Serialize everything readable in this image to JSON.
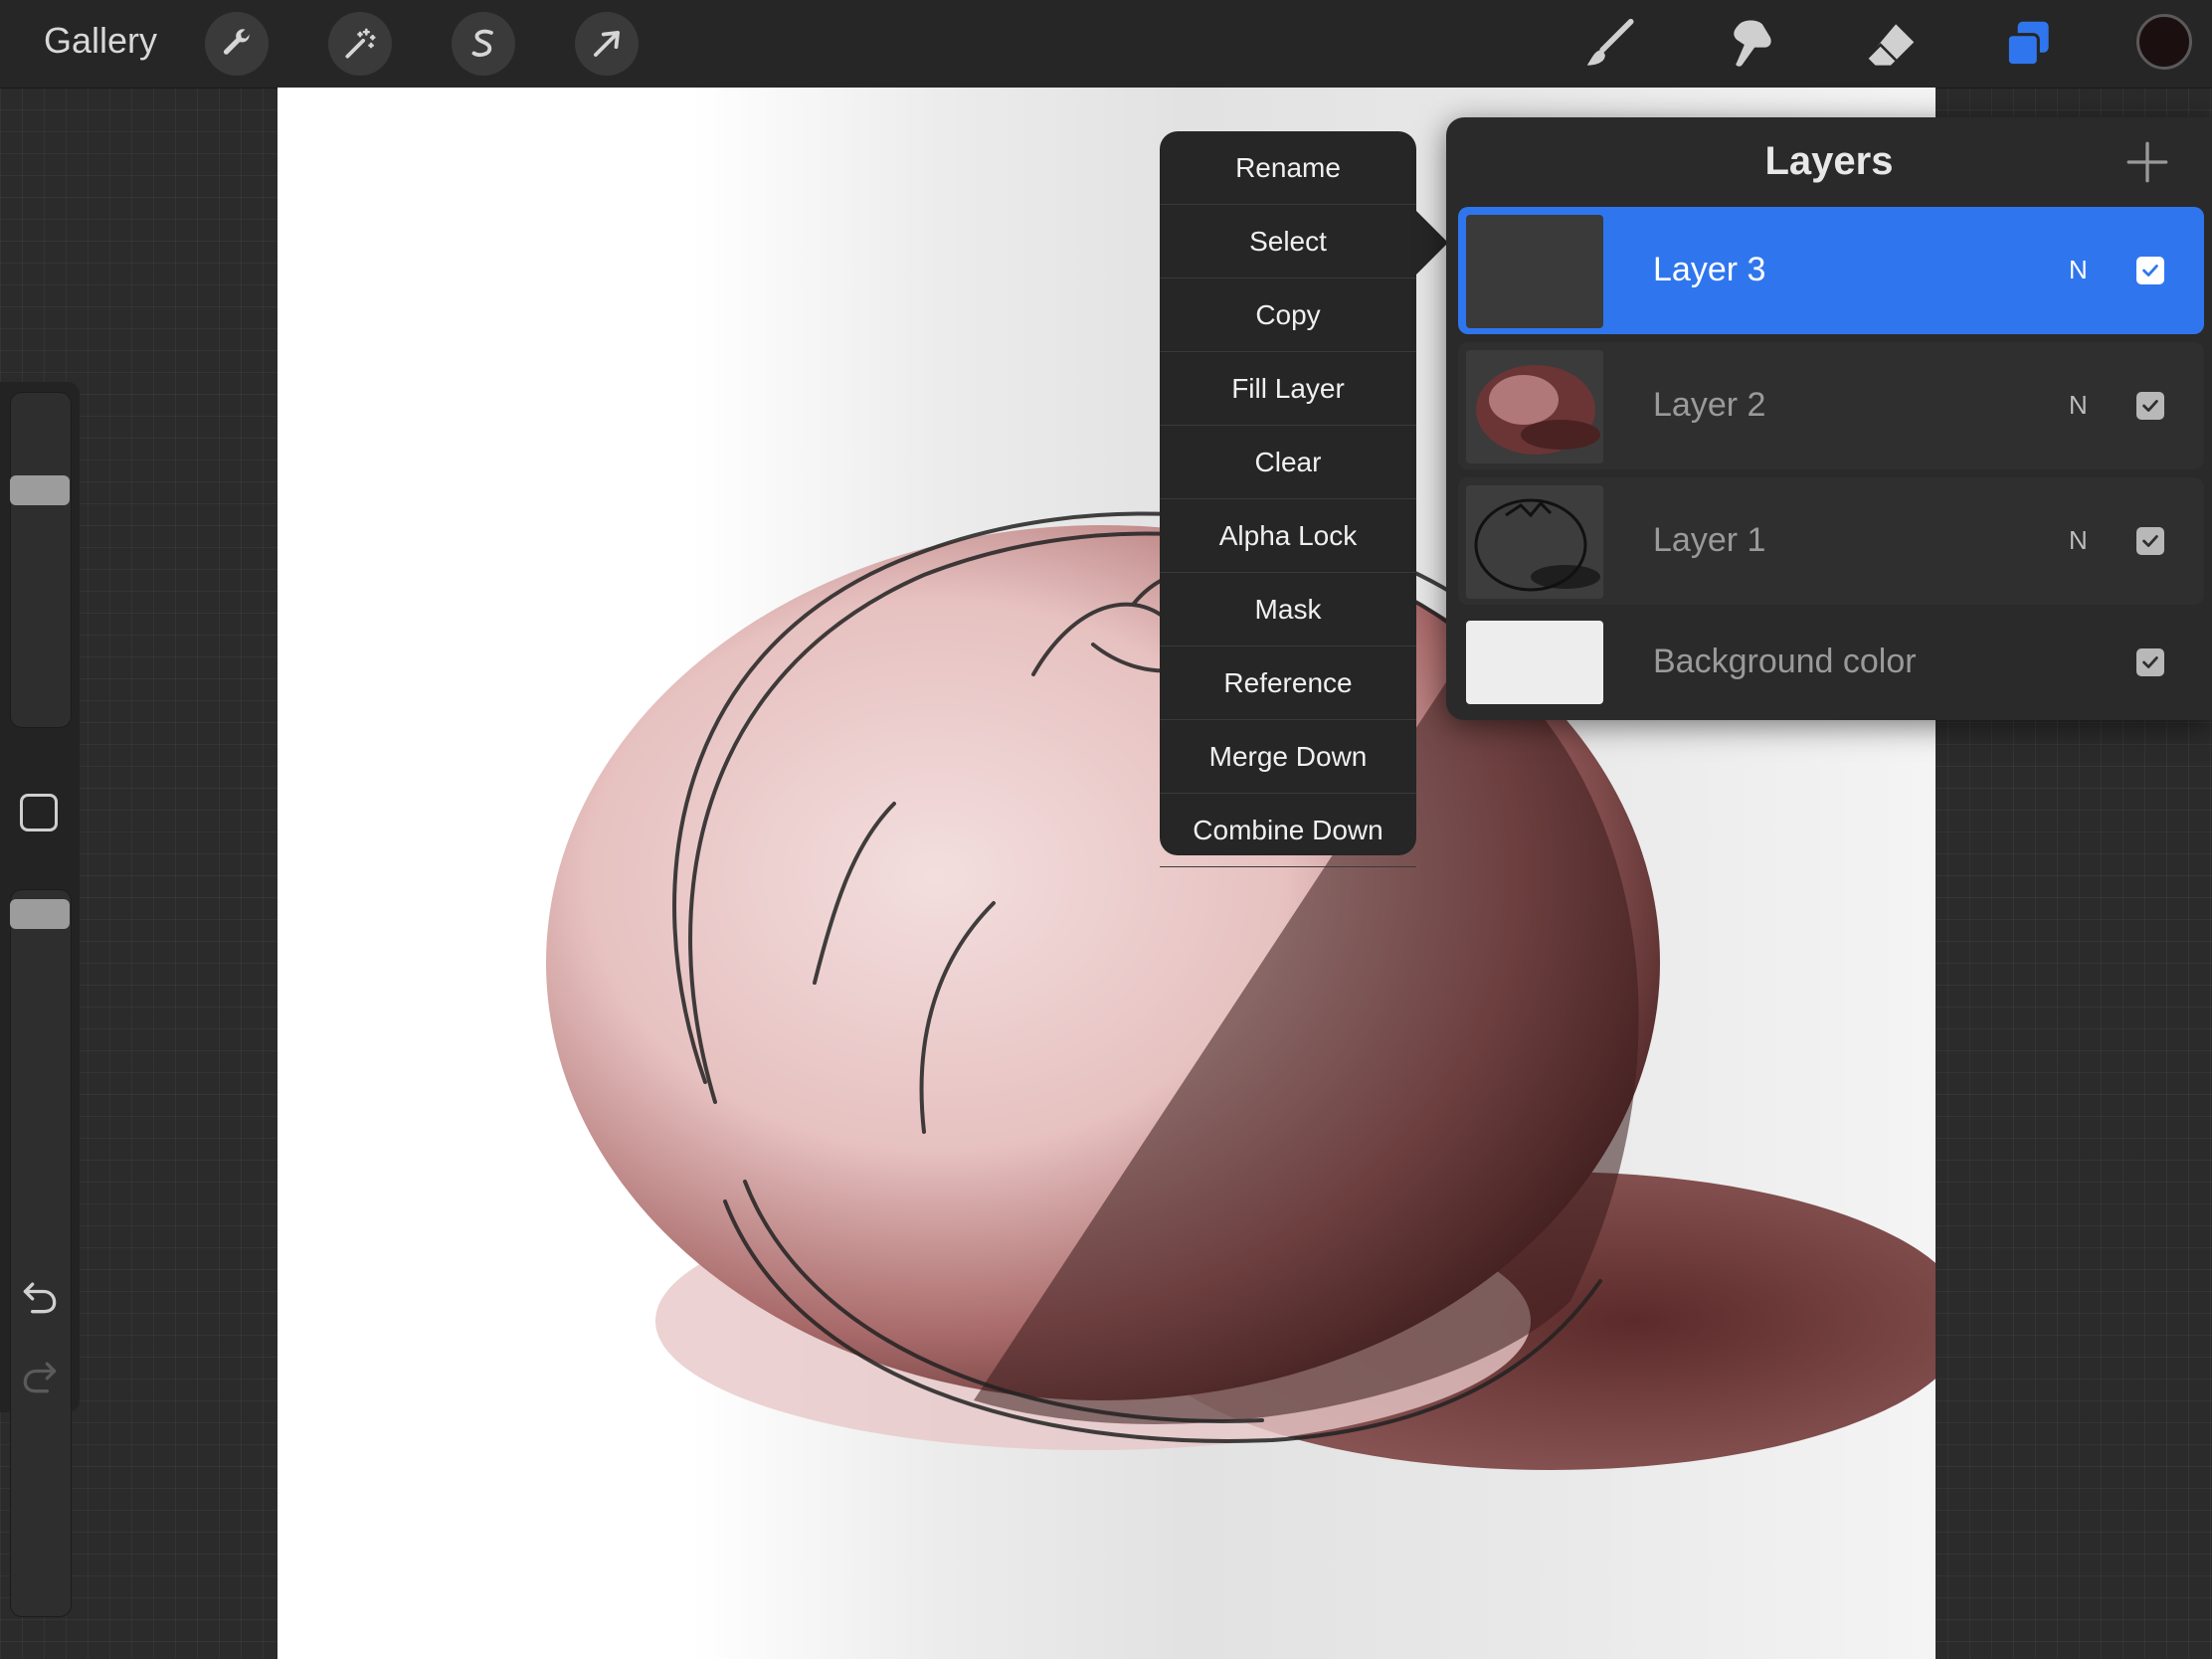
{
  "topbar": {
    "gallery_label": "Gallery",
    "left_tools": [
      "wrench-icon",
      "magic-wand-icon",
      "selection-s-icon",
      "transform-arrow-icon"
    ],
    "right_tools": [
      "brush-icon",
      "smudge-icon",
      "eraser-icon",
      "layers-icon"
    ],
    "active_tool": "layers-icon",
    "current_color": "#1c0f10"
  },
  "sidebar": {
    "brush_size": 0.7,
    "brush_opacity": 1.0
  },
  "context_menu": {
    "items": [
      "Rename",
      "Select",
      "Copy",
      "Fill Layer",
      "Clear",
      "Alpha Lock",
      "Mask",
      "Reference",
      "Merge Down",
      "Combine Down"
    ]
  },
  "layers_panel": {
    "title": "Layers",
    "layers": [
      {
        "name": "Layer 3",
        "mode": "N",
        "visible": true,
        "active": true
      },
      {
        "name": "Layer 2",
        "mode": "N",
        "visible": true,
        "active": false
      },
      {
        "name": "Layer 1",
        "mode": "N",
        "visible": true,
        "active": false
      },
      {
        "name": "Background color",
        "mode": "",
        "visible": true,
        "active": false
      }
    ]
  },
  "colors": {
    "accent": "#2f76ee",
    "panel": "#2a2a2a",
    "menu": "#262626"
  }
}
